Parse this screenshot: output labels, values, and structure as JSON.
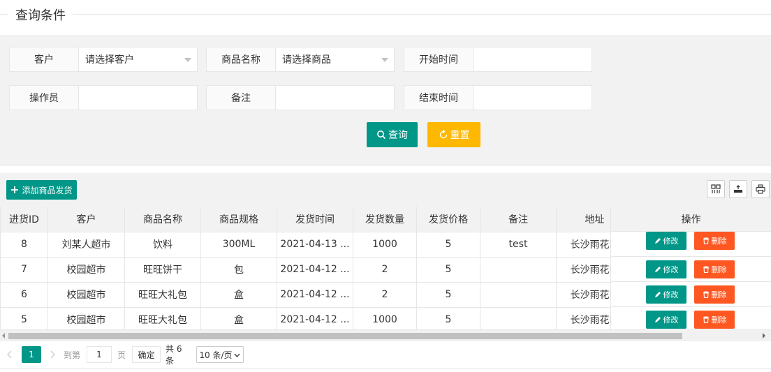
{
  "legend": {
    "title": "查询条件"
  },
  "form": {
    "customer": {
      "label": "客户",
      "value": "请选择客户"
    },
    "product": {
      "label": "商品名称",
      "value": "请选择商品"
    },
    "start_time": {
      "label": "开始时间",
      "value": ""
    },
    "operator": {
      "label": "操作员",
      "value": ""
    },
    "remark": {
      "label": "备注",
      "value": ""
    },
    "end_time": {
      "label": "结束时间",
      "value": ""
    },
    "query_label": "查询",
    "reset_label": "重置"
  },
  "toolbar": {
    "add_label": "添加商品发货"
  },
  "table": {
    "headers": [
      "进货ID",
      "客户",
      "商品名称",
      "商品规格",
      "发货时间",
      "发货数量",
      "发货价格",
      "备注",
      "地址",
      "操作"
    ],
    "rows": [
      [
        "8",
        "刘某人超市",
        "饮料",
        "300ML",
        "2021-04-13 ...",
        "1000",
        "5",
        "test",
        "长沙雨花区"
      ],
      [
        "7",
        "校园超市",
        "旺旺饼干",
        "包",
        "2021-04-12 ...",
        "2",
        "5",
        "",
        "长沙雨花区"
      ],
      [
        "6",
        "校园超市",
        "旺旺大礼包",
        "盒",
        "2021-04-12 ...",
        "2",
        "5",
        "",
        "长沙雨花区"
      ],
      [
        "5",
        "校园超市",
        "旺旺大礼包",
        "盒",
        "2021-04-12 ...",
        "1000",
        "5",
        "",
        "长沙雨花区"
      ]
    ],
    "edit_label": "修改",
    "delete_label": "删除"
  },
  "pager": {
    "current_page": "1",
    "goto_label": "到第",
    "goto_value": "1",
    "page_unit": "页",
    "confirm_label": "确定",
    "total_label": "共 6 条",
    "page_size": "10 条/页"
  },
  "colors": {
    "primary": "#009688",
    "warm": "#FFB800",
    "danger": "#FF5722"
  }
}
